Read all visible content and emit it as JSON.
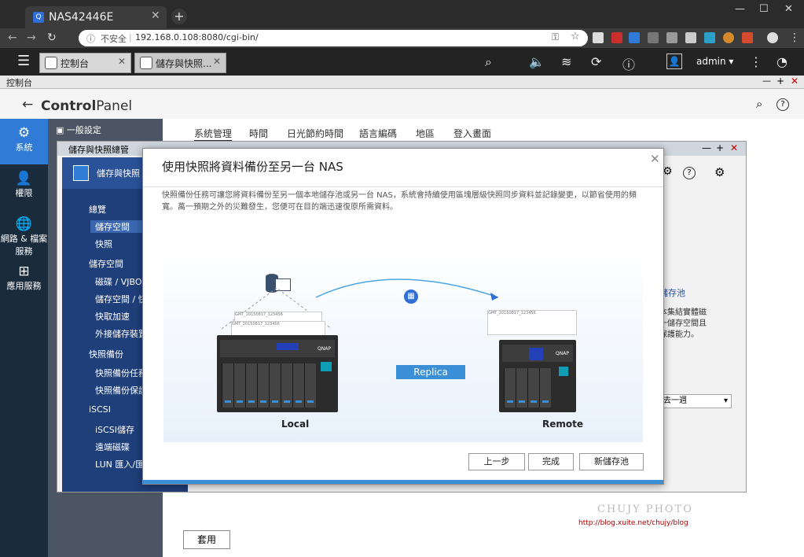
{
  "browser": {
    "tab_title": "NAS42446E",
    "secure_label": "不安全",
    "url": "192.168.0.108:8080/cgi-bin/",
    "new_tab": "+",
    "close": "✕",
    "win_min": "—",
    "win_max": "☐",
    "win_close": "✕"
  },
  "qts": {
    "tabs": [
      {
        "label": "控制台"
      },
      {
        "label": "儲存與快照..."
      }
    ],
    "user": "admin ▾"
  },
  "control_panel": {
    "window_title": "控制台",
    "title_bold": "Control",
    "title_rest": "Panel",
    "back": "←",
    "nav": [
      {
        "label": "系統",
        "icon": "⚙"
      },
      {
        "label": "權限",
        "icon": "👤"
      },
      {
        "label": "網路 & 檔案服務",
        "icon": "🌐"
      },
      {
        "label": "應用服務",
        "icon": "⊞"
      }
    ],
    "subnav": [
      {
        "label": "一般設定"
      },
      {
        "label": "儲存與快照總管"
      }
    ],
    "setting_tabs": [
      "系統管理",
      "時間",
      "日光節約時間",
      "語言編碼",
      "地區",
      "登入畫面"
    ],
    "apply_label": "套用"
  },
  "storage_window": {
    "title": "儲存與快照總管",
    "header": "儲存與快照",
    "sidebar": [
      {
        "label": "總覽",
        "section": true
      },
      {
        "label": "儲存空間",
        "section": false
      },
      {
        "label": "快照",
        "section": false
      },
      {
        "label": "儲存空間",
        "section": true
      },
      {
        "label": "磁碟 / VJBOD",
        "section": false
      },
      {
        "label": "儲存空間 / 快",
        "section": false
      },
      {
        "label": "快取加速",
        "section": false
      },
      {
        "label": "外接儲存裝置",
        "section": false
      },
      {
        "label": "快照備份",
        "section": true
      },
      {
        "label": "快照備份任務",
        "section": false
      },
      {
        "label": "快照備份保護",
        "section": false
      },
      {
        "label": "iSCSI",
        "section": true
      },
      {
        "label": "iSCSI儲存",
        "section": false
      },
      {
        "label": "遠端磁碟",
        "section": false
      },
      {
        "label": "LUN 匯入/匯",
        "section": false
      }
    ],
    "right_title": "儲存池",
    "right_text_1": "本集結實體磁",
    "right_text_2": "一儲存空間且",
    "right_text_3": "保護能力。",
    "select_value": "去一週"
  },
  "modal": {
    "title": "使用快照將資料備份至另一台 NAS",
    "description": "快照備份任務可讓您將資料備份至另一個本地儲存池或另一台 NAS，系統會持續使用區塊層級快照同步資料並記錄變更，以節省使用的頻寬。萬一預期之外的災難發生，您便可在目的端迅速復原所需資料。",
    "illustration": {
      "replica_label": "Replica",
      "local_label": "Local",
      "remote_label": "Remote",
      "nas_brand": "QNAP",
      "doc_label": "GMT_20150817_123456"
    },
    "buttons": {
      "prev": "上一步",
      "finish": "完成",
      "new_pool": "新儲存池"
    }
  },
  "watermark": {
    "name": "CHUJY PHOTO",
    "url": "http://blog.xuite.net/chujy/blog"
  }
}
